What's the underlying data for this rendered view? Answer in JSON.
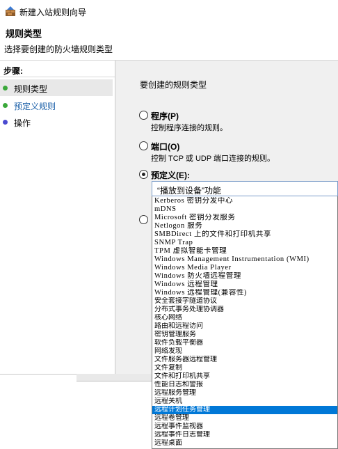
{
  "window": {
    "title": "新建入站规则向导"
  },
  "header": {
    "title": "规则类型",
    "subtitle": "选择要创建的防火墙规则类型"
  },
  "steps": {
    "title": "步骤:",
    "items": [
      {
        "label": "规则类型",
        "color": "#3aa83a"
      },
      {
        "label": "预定义规则",
        "color": "#3aa83a"
      },
      {
        "label": "操作",
        "color": "#4a4ad0"
      }
    ]
  },
  "main": {
    "prompt": "要创建的规则类型",
    "options": [
      {
        "label": "程序(P)",
        "desc": "控制程序连接的规则。"
      },
      {
        "label": "端口(O)",
        "desc": "控制 TCP 或 UDP 端口连接的规则。"
      },
      {
        "label": "预定义(E):",
        "desc": ""
      }
    ],
    "predefined_select": {
      "value": "“播放到设备”功能"
    },
    "predefined_options": [
      "Kerberos 密钥分发中心",
      "mDNS",
      "Microsoft 密钥分发服务",
      "Netlogon 服务",
      "SMBDirect 上的文件和打印机共享",
      "SNMP Trap",
      "TPM 虚拟智能卡管理",
      "Windows Management Instrumentation (WMI)",
      "Windows Media Player",
      "Windows 防火墙远程管理",
      "Windows 远程管理",
      "Windows 远程管理(兼容性)",
      "安全套接字隧道协议",
      "分布式事务处理协调器",
      "核心网络",
      "路由和远程访问",
      "密钥管理服务",
      "软件负载平衡器",
      "网络发现",
      "文件服务器远程管理",
      "文件复制",
      "文件和打印机共享",
      "性能日志和警报",
      "远程服务管理",
      "远程关机",
      "远程计划任务管理",
      "远程卷管理",
      "远程事件监视器",
      "远程事件日志管理",
      "远程桌面"
    ],
    "selected_index": 25
  }
}
